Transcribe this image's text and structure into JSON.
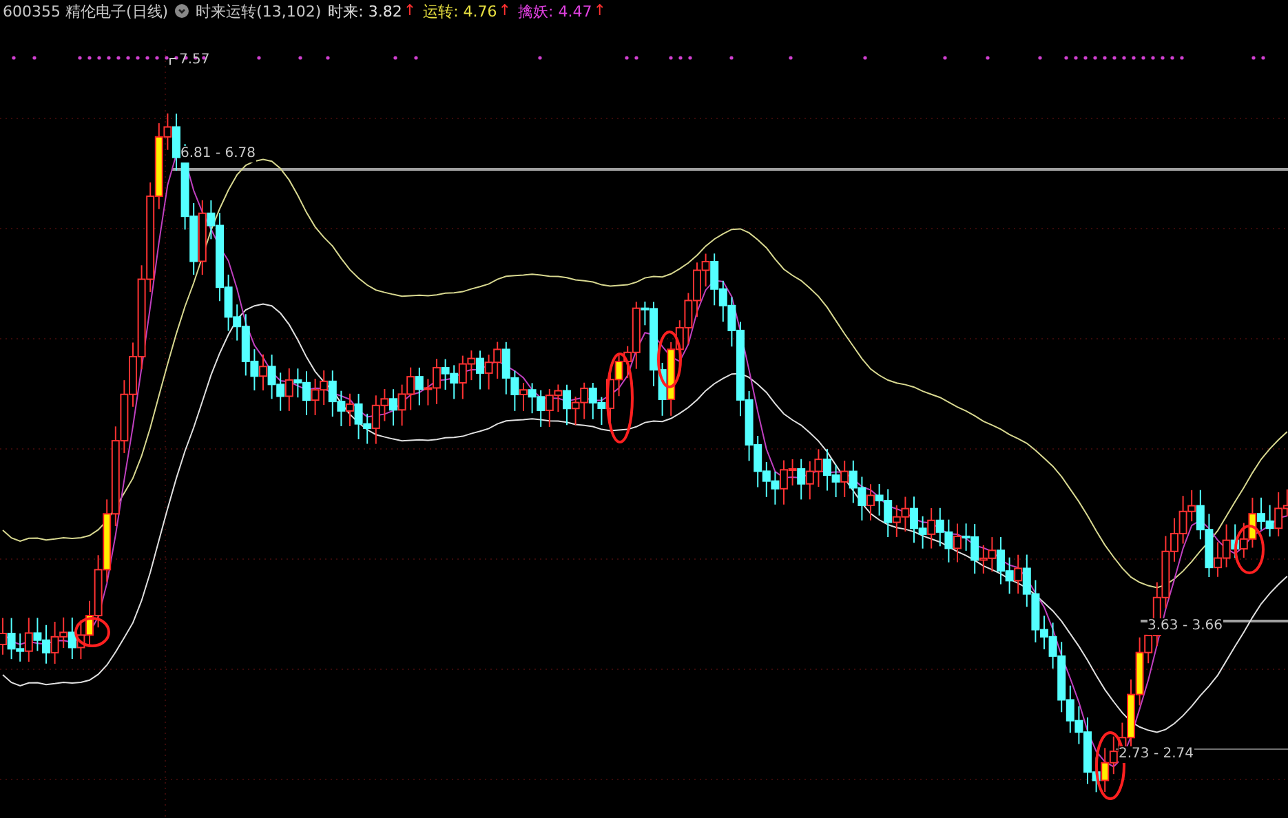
{
  "header": {
    "stock": "600355 精伦电子(日线)",
    "indicator": "时来运转(13,102)",
    "values": [
      {
        "label": "时来: 3.82",
        "arrow": "↑",
        "color": "#e0e0e0"
      },
      {
        "label": "运转: 4.76",
        "arrow": "↑",
        "color": "#e8e040"
      },
      {
        "label": "擒妖: 4.47",
        "arrow": "↑",
        "color": "#e040e0"
      }
    ]
  },
  "chart": {
    "price_labels": [
      {
        "kind": "high",
        "text": "7.57"
      },
      {
        "kind": "range",
        "text": "6.81 - 6.78"
      },
      {
        "kind": "range",
        "text": "3.63 - 3.66"
      },
      {
        "kind": "range",
        "text": "2.73 - 2.74"
      }
    ]
  }
}
